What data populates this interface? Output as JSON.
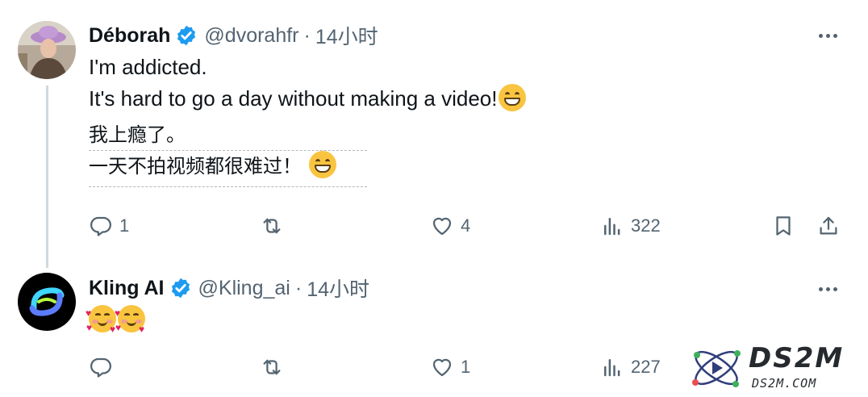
{
  "tweets": [
    {
      "name": "Déborah",
      "handle": "@dvorahfr",
      "separator": "·",
      "time": "14小时",
      "lines": [
        "I'm addicted.",
        "It's hard to go a day without making a video!"
      ],
      "translation": [
        "我上瘾了。",
        "一天不拍视频都很难过！"
      ],
      "emoji": "grinning-face",
      "stats": {
        "replies": "1",
        "likes": "4",
        "views": "322"
      },
      "avatar": "user-avatar-photo"
    },
    {
      "name": "Kling AI",
      "handle": "@Kling_ai",
      "separator": "·",
      "time": "14小时",
      "emojis": [
        "smiling-face-with-hearts",
        "smiling-face-with-hearts"
      ],
      "stats": {
        "likes": "1",
        "views": "227"
      },
      "avatar": "kling-logo"
    }
  ],
  "icons": {
    "reply": "reply-icon",
    "retweet": "retweet-icon",
    "like": "like-icon",
    "views": "views-icon",
    "bookmark": "bookmark-icon",
    "share": "share-icon",
    "more": "more-icon",
    "verified": "verified-badge-icon"
  },
  "colors": {
    "verified": "#1d9bf0",
    "secondary_text": "#536471",
    "thread_line": "#cfd9de"
  },
  "watermark": {
    "title": "DS2M",
    "subtitle": "DS2M.COM"
  }
}
